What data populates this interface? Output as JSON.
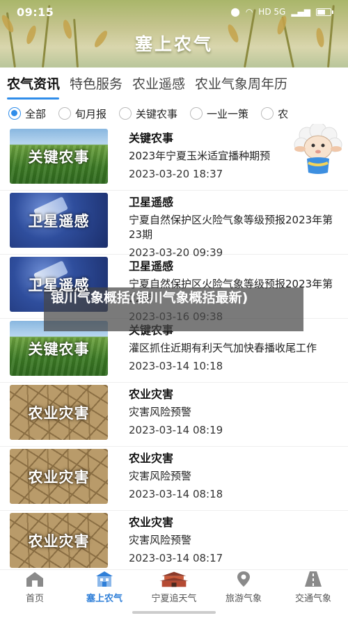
{
  "status": {
    "time": "09:15",
    "network": "HD 5G"
  },
  "header": {
    "title": "塞上农气"
  },
  "tabs": [
    {
      "label": "农气资讯",
      "active": true
    },
    {
      "label": "特色服务"
    },
    {
      "label": "农业遥感"
    },
    {
      "label": "农业气象周年历"
    }
  ],
  "filters": [
    {
      "label": "全部",
      "selected": true
    },
    {
      "label": "旬月报"
    },
    {
      "label": "关键农事"
    },
    {
      "label": "一业一策"
    },
    {
      "label": "农"
    }
  ],
  "items": [
    {
      "thumb": "关键农事",
      "category": "关键农事",
      "headline": "2023年宁夏玉米适宜播种期预",
      "date": "2023-03-20 18:37"
    },
    {
      "thumb": "卫星遥感",
      "category": "卫星遥感",
      "headline": "宁夏自然保护区火险气象等级预报2023年第23期",
      "date": "2023-03-20 09:39"
    },
    {
      "thumb": "卫星遥感",
      "category": "卫星遥感",
      "headline": "宁夏自然保护区火险气象等级预报2023年第22期",
      "date": "2023-03-16 09:38"
    },
    {
      "thumb": "关键农事",
      "category": "关键农事",
      "headline": "灌区抓住近期有利天气加快春播收尾工作",
      "date": "2023-03-14 10:18"
    },
    {
      "thumb": "农业灾害",
      "category": "农业灾害",
      "headline": "灾害风险预警",
      "date": "2023-03-14 08:19"
    },
    {
      "thumb": "农业灾害",
      "category": "农业灾害",
      "headline": "灾害风险预警",
      "date": "2023-03-14 08:18"
    },
    {
      "thumb": "农业灾害",
      "category": "农业灾害",
      "headline": "灾害风险预警",
      "date": "2023-03-14 08:17"
    }
  ],
  "overlay": {
    "text": "银川气象概括(银川气象概括最新)"
  },
  "bottom_nav": [
    {
      "label": "首页",
      "icon": "home-icon"
    },
    {
      "label": "塞上农气",
      "icon": "farm-building-icon",
      "active": true
    },
    {
      "label": "宁夏追天气",
      "icon": "pagoda-icon"
    },
    {
      "label": "旅游气象",
      "icon": "location-pin-icon"
    },
    {
      "label": "交通气象",
      "icon": "road-icon"
    }
  ],
  "colors": {
    "accent": "#2f8dea",
    "banner": "#b9c08a"
  }
}
